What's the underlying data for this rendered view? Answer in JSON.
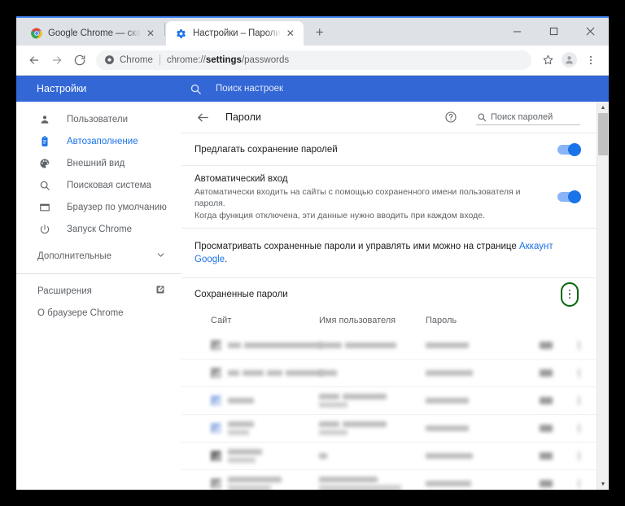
{
  "window": {
    "controls": {
      "minimize": "—",
      "maximize": "▫",
      "close": "✕"
    }
  },
  "tabs": [
    {
      "title": "Google Chrome — скачать бесп",
      "favicon": "chrome-logo-icon",
      "active": false,
      "close": "✕"
    },
    {
      "title": "Настройки – Пароли",
      "favicon": "gear-icon",
      "active": true,
      "close": "✕"
    }
  ],
  "newtab_label": "+",
  "toolbar": {
    "back": "←",
    "forward": "→",
    "reload": "⟳",
    "omnibox": {
      "security_icon": "chrome-shield-icon",
      "scheme_label": "Chrome",
      "url_prefix": "chrome://",
      "url_bold": "settings",
      "url_suffix": "/passwords"
    },
    "bookmark_icon": "star-icon",
    "profile_icon": "avatar-person-icon",
    "menu_icon": "three-dot-menu-icon"
  },
  "settings_header": {
    "title": "Настройки",
    "search_placeholder": "Поиск настроек",
    "search_icon": "search-icon",
    "bg_color": "#3367d6"
  },
  "sidebar": {
    "items": [
      {
        "label": "Пользователи",
        "icon": "person-icon",
        "active": false
      },
      {
        "label": "Автозаполнение",
        "icon": "clipboard-icon",
        "active": true
      },
      {
        "label": "Внешний вид",
        "icon": "palette-icon",
        "active": false
      },
      {
        "label": "Поисковая система",
        "icon": "search-icon",
        "active": false
      },
      {
        "label": "Браузер по умолчанию",
        "icon": "window-icon",
        "active": false
      },
      {
        "label": "Запуск Chrome",
        "icon": "power-icon",
        "active": false
      }
    ],
    "expand": {
      "label": "Дополнительные",
      "icon": "chevron-down-icon"
    },
    "footer": [
      {
        "label": "Расширения",
        "icon": "external-link-icon"
      },
      {
        "label": "О браузере Chrome",
        "icon": ""
      }
    ],
    "active_color": "#1a73e8"
  },
  "main": {
    "back_icon": "back-arrow-icon",
    "title": "Пароли",
    "help_icon": "help-circle-icon",
    "search": {
      "icon": "search-icon",
      "placeholder": "Поиск паролей"
    },
    "offer_save": {
      "title": "Предлагать сохранение паролей",
      "toggle_on": true
    },
    "auto_signin": {
      "title": "Автоматический вход",
      "sub_line1": "Автоматически входить на сайты с помощью сохраненного имени пользователя и пароля.",
      "sub_line2": "Когда функция отключена, эти данные нужно вводить при каждом входе.",
      "toggle_on": true
    },
    "note": {
      "text_before": "Просматривать сохраненные пароли и управлять ими можно на странице ",
      "link": "Аккаунт Google",
      "text_after": "."
    },
    "saved": {
      "heading": "Сохраненные пароли",
      "menu_icon": "three-dot-menu-icon",
      "highlight_color": "#056608"
    },
    "table": {
      "headers": [
        "Сайт",
        "Имя пользователя",
        "Пароль"
      ],
      "rows": [
        {
          "favicon": "grey",
          "site_widths": [
            16,
            96
          ],
          "user_widths": [
            28,
            63
          ],
          "pass_width": 53,
          "two_line_site": false,
          "two_line_user": false
        },
        {
          "favicon": "grey",
          "site_widths": [
            14,
            26,
            19,
            46
          ],
          "user_widths": [
            22
          ],
          "pass_width": 58,
          "two_line_site": false,
          "two_line_user": false
        },
        {
          "favicon": "blue",
          "site_widths": [
            32
          ],
          "user_widths": [
            25,
            54
          ],
          "pass_width": 53,
          "two_line_site": false,
          "two_line_user": true
        },
        {
          "favicon": "blue",
          "site_widths": [
            32
          ],
          "user_widths": [
            25,
            54
          ],
          "pass_width": 53,
          "two_line_site": true,
          "two_line_user": true
        },
        {
          "favicon": "dk",
          "site_widths": [
            42
          ],
          "user_widths": [
            10
          ],
          "pass_width": 58,
          "two_line_site": true,
          "two_line_user": false
        },
        {
          "favicon": "grey",
          "site_widths": [
            66
          ],
          "user_widths": [
            72
          ],
          "pass_width": 56,
          "two_line_site": true,
          "two_line_user": true
        }
      ]
    }
  },
  "scrollbar": {
    "up_arrow": "▲",
    "down_arrow": "▼"
  }
}
